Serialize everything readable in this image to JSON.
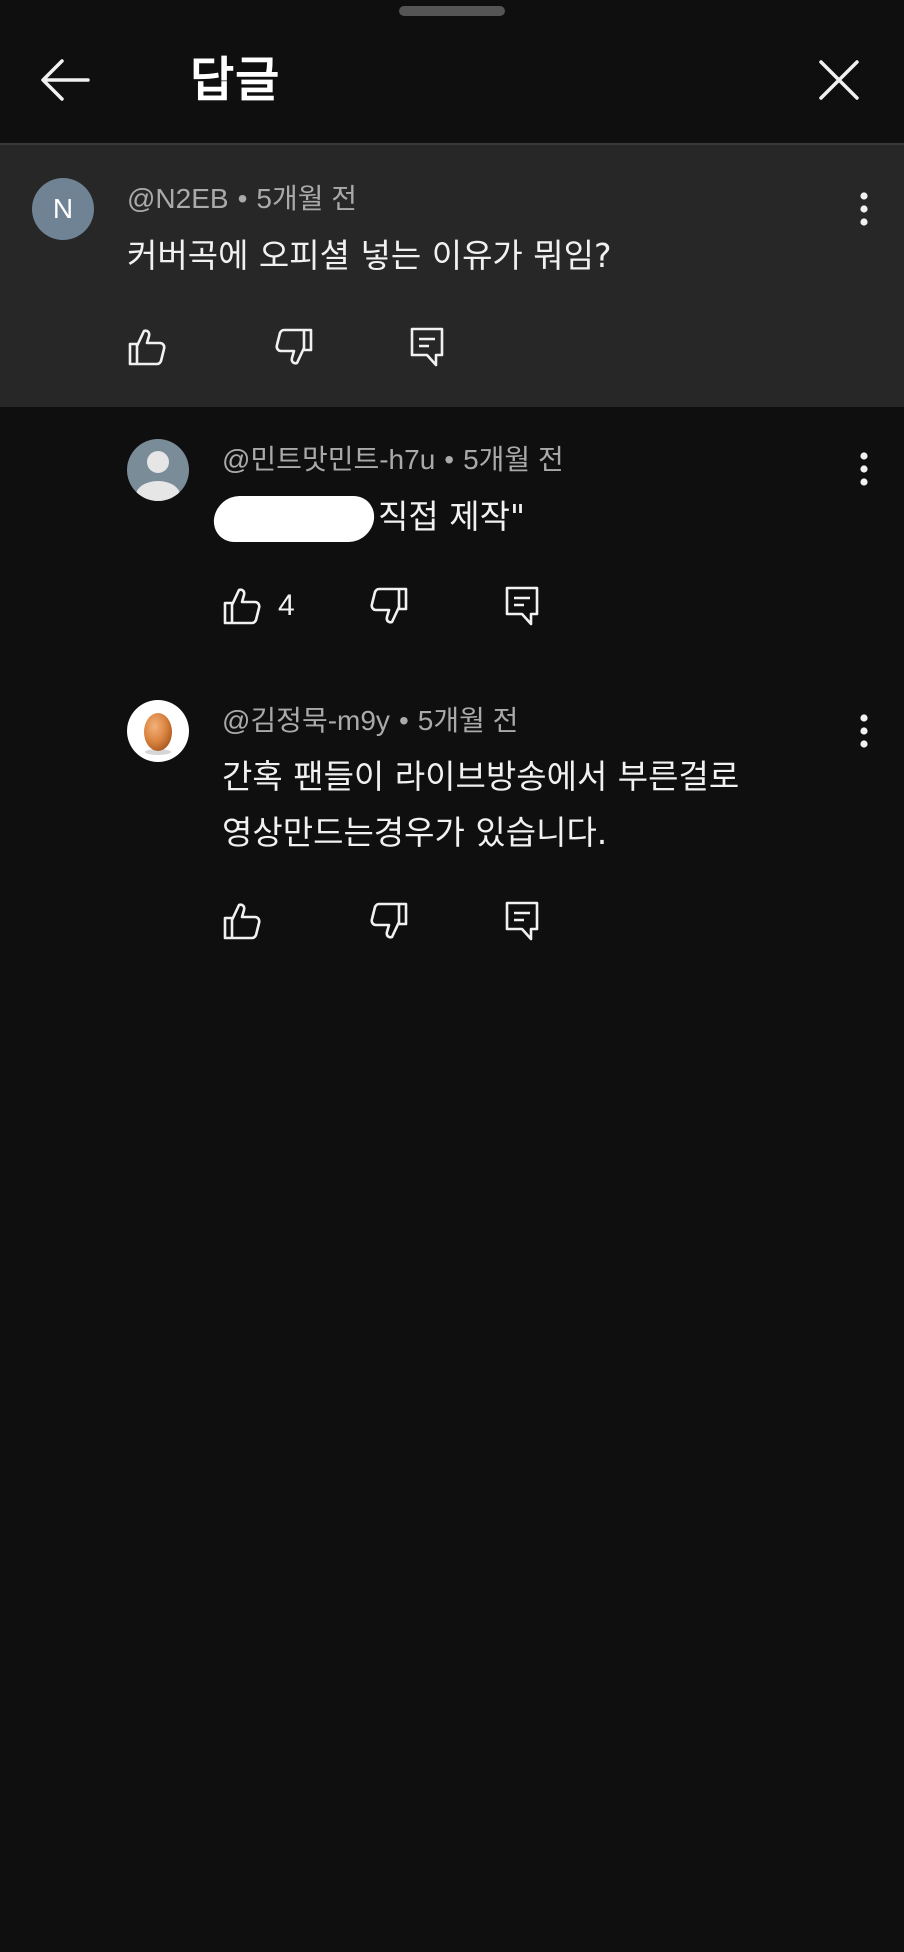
{
  "header": {
    "title": "답글"
  },
  "comments": [
    {
      "avatar_letter": "N",
      "author": "@N2EB",
      "time": "5개월 전",
      "text": "커버곡에 오피셜 넣는 이유가 뭐임?",
      "likes": ""
    },
    {
      "author": "@민트맛민트-h7u",
      "time": "5개월 전",
      "text": "직접 제작\"",
      "likes": "4"
    },
    {
      "author": "@김정묵-m9y",
      "time": "5개월 전",
      "text_line1": "간혹 팬들이 라이브방송에서 부른걸로",
      "text_line2": "영상만드는경우가 있습니다.",
      "likes": ""
    }
  ],
  "icons": {
    "back": "arrow-left-icon",
    "close": "close-icon",
    "like": "thumb-up-icon",
    "dislike": "thumb-down-icon",
    "reply": "comment-reply-icon",
    "more": "more-vert-icon"
  },
  "colors": {
    "background": "#0f0f0f",
    "highlight": "#272727",
    "text": "#f1f1f1",
    "meta": "#aaaaaa"
  }
}
